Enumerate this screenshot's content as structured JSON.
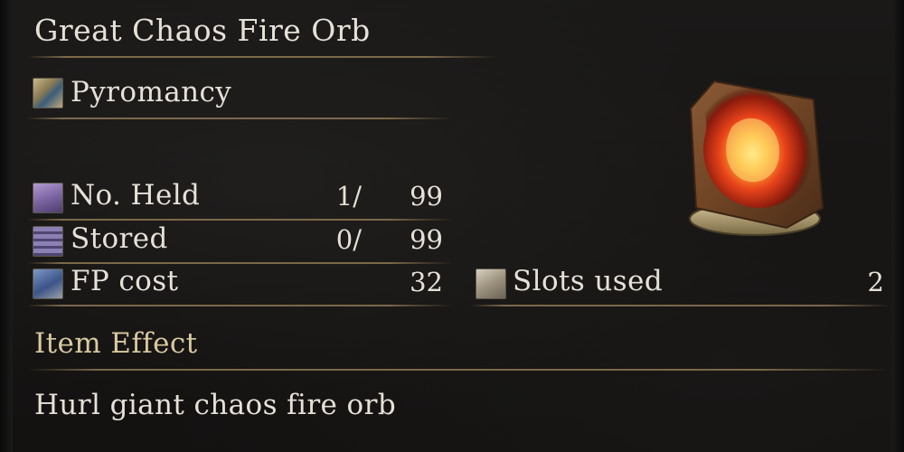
{
  "item": {
    "name": "Great Chaos Fire Orb",
    "category": "Pyromancy",
    "icon": "pyromancy-scroll-fire-icon"
  },
  "stats": {
    "held": {
      "label": "No. Held",
      "current": "1/",
      "max": "99",
      "icon": "pouch-icon"
    },
    "stored": {
      "label": "Stored",
      "current": "0/",
      "max": "99",
      "icon": "chest-icon"
    },
    "fp_cost": {
      "label": "FP cost",
      "value": "32",
      "icon": "fp-icon"
    },
    "slots_used": {
      "label": "Slots used",
      "value": "2",
      "icon": "attunement-slot-icon"
    }
  },
  "effect": {
    "heading": "Item Effect",
    "text": "Hurl giant chaos fire orb"
  },
  "colors": {
    "accent_gold": "#d9c9a0",
    "text": "#e6e1d8",
    "rule": "#8c7652",
    "background": "#151413"
  }
}
